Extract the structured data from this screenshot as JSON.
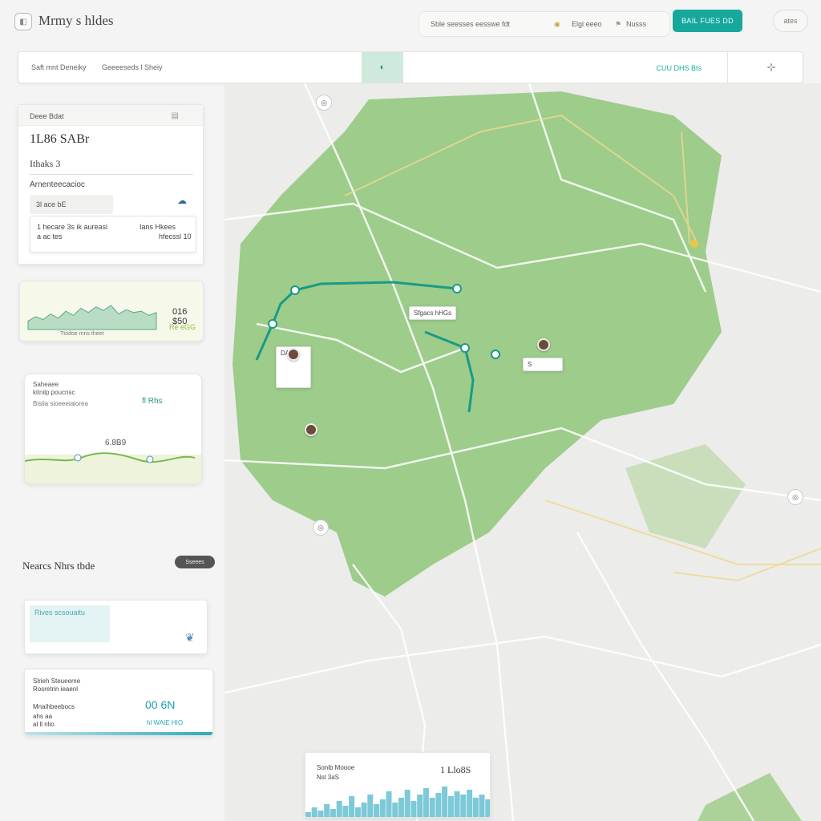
{
  "header": {
    "app_icon": "window-icon",
    "title": "Mrmy s hldes",
    "pill_text_1": "Sble seesses eesswe fdt",
    "pill_text_2": "Elgi eeeo",
    "pill_text_3": "Nusss",
    "cta_label": "BAIL FUES DD",
    "settings_label": "ates"
  },
  "search": {
    "label_1": "Saft mnt Deneiky",
    "label_2": "Geeeeseds l Sheiy",
    "toggle_icon": "route-icon",
    "value": "CUU DHS Bts",
    "action_icon": "locate-icon"
  },
  "card_summary": {
    "header": "Deee Bdat",
    "header_icon": "chart-icon",
    "amount": "1L86 SABr",
    "subtitle": "Ithaks 3",
    "section": "Arnenteecacioc",
    "chip": "3l ace bE",
    "chip_icon": "cloud-icon",
    "inner_left": "1 hecare 3s ik aureasi",
    "inner_left_2": "a ac tes",
    "inner_right": "Ians Hkees",
    "inner_right_2": "hfecssl 10"
  },
  "card_elevation": {
    "value": "016 $50",
    "change": "Re eGG",
    "caption": "Ttodoe mns theet",
    "series": [
      12,
      18,
      14,
      22,
      16,
      26,
      20,
      30,
      24,
      32,
      27,
      34,
      22,
      28,
      24,
      26,
      20,
      24
    ]
  },
  "card_route": {
    "title": "Saheaee",
    "line_1": "kitnilp poucnsc",
    "line_2": "Bisiia sioeeeiaiorea",
    "badge": "fl Rhs",
    "value": "6.8B9"
  },
  "section": {
    "title": "Nearcs Nhrs tbde",
    "button": "Sseees"
  },
  "card_note": {
    "title": "Rives scsouaitu",
    "icon": "bird-icon"
  },
  "card_stats": {
    "line_1": "Slrieh Steueeme",
    "line_2": "Rosretrin ieaenl",
    "line_3": "Mnaihbeebocs",
    "line_4": "ahs aa",
    "line_5": "al ll nlio",
    "big": "00 6N",
    "sub": "hl WAIE HIO"
  },
  "card_chart": {
    "title": "Sonib Moooe",
    "subtitle": "Nsl 3aS",
    "value": "1 Llo8S",
    "series": [
      8,
      14,
      10,
      18,
      12,
      22,
      16,
      28,
      14,
      20,
      30,
      18,
      24,
      34,
      20,
      26,
      36,
      22,
      30,
      38,
      26,
      32,
      40,
      28,
      34,
      30,
      36,
      26,
      30,
      24
    ]
  },
  "map": {
    "labels": [
      "Sfgacs hHGs",
      "DAH",
      "S"
    ],
    "pins": [
      "person-pin-icon",
      "person-pin-icon",
      "person-pin-icon"
    ],
    "colors": {
      "park": "#8fc77a",
      "route": "#1a9a86",
      "road": "#ffffff",
      "base": "#ececea"
    }
  }
}
